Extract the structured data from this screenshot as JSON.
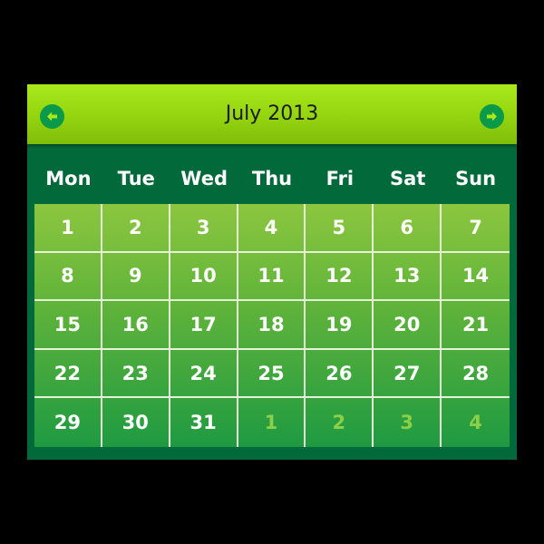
{
  "calendar": {
    "title": "July 2013",
    "prev_icon": "arrow-left-icon",
    "next_icon": "arrow-right-icon",
    "weekdays": [
      "Mon",
      "Tue",
      "Wed",
      "Thu",
      "Fri",
      "Sat",
      "Sun"
    ],
    "weeks": [
      [
        {
          "d": "1",
          "o": false
        },
        {
          "d": "2",
          "o": false
        },
        {
          "d": "3",
          "o": false
        },
        {
          "d": "4",
          "o": false
        },
        {
          "d": "5",
          "o": false
        },
        {
          "d": "6",
          "o": false
        },
        {
          "d": "7",
          "o": false
        }
      ],
      [
        {
          "d": "8",
          "o": false
        },
        {
          "d": "9",
          "o": false
        },
        {
          "d": "10",
          "o": false
        },
        {
          "d": "11",
          "o": false
        },
        {
          "d": "12",
          "o": false
        },
        {
          "d": "13",
          "o": false
        },
        {
          "d": "14",
          "o": false
        }
      ],
      [
        {
          "d": "15",
          "o": false
        },
        {
          "d": "16",
          "o": false
        },
        {
          "d": "17",
          "o": false
        },
        {
          "d": "18",
          "o": false
        },
        {
          "d": "19",
          "o": false
        },
        {
          "d": "20",
          "o": false
        },
        {
          "d": "21",
          "o": false
        }
      ],
      [
        {
          "d": "22",
          "o": false
        },
        {
          "d": "23",
          "o": false
        },
        {
          "d": "24",
          "o": false
        },
        {
          "d": "25",
          "o": false
        },
        {
          "d": "26",
          "o": false
        },
        {
          "d": "27",
          "o": false
        },
        {
          "d": "28",
          "o": false
        }
      ],
      [
        {
          "d": "29",
          "o": false
        },
        {
          "d": "30",
          "o": false
        },
        {
          "d": "31",
          "o": false
        },
        {
          "d": "1",
          "o": true
        },
        {
          "d": "2",
          "o": true
        },
        {
          "d": "3",
          "o": true
        },
        {
          "d": "4",
          "o": true
        }
      ]
    ],
    "colors": {
      "header": "#a9e81a",
      "body": "#02693a",
      "accent": "#0a9a4a",
      "other_month": "#8cd048"
    }
  }
}
